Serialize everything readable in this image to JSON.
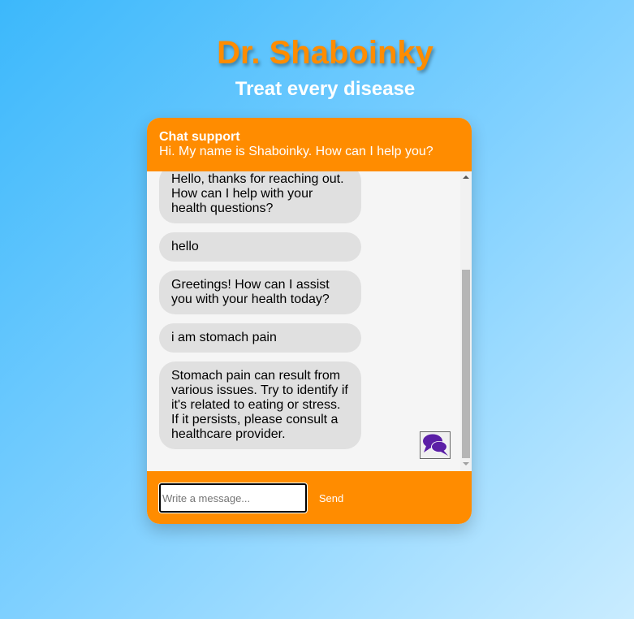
{
  "page": {
    "title": "Dr. Shaboinky",
    "subtitle": "Treat every disease"
  },
  "chat": {
    "header_title": "Chat support",
    "header_description": "Hi. My name is Shaboinky. How can I help you?",
    "messages": [
      {
        "text": "Hello, thanks for reaching out. How can I help with your health questions?"
      },
      {
        "text": "hello"
      },
      {
        "text": "Greetings! How can I assist you with your health today?"
      },
      {
        "text": "i am stomach pain"
      },
      {
        "text": "Stomach pain can result from various issues. Try to identify if it's related to eating or stress. If it persists, please consult a healthcare provider."
      }
    ],
    "input_placeholder": "Write a message...",
    "input_value": "",
    "send_label": "Send",
    "toggle_icon": "chat-bubbles-icon"
  },
  "colors": {
    "accent": "#ff8c00",
    "bubble": "#e0e0e0",
    "icon": "#5b1fa6"
  }
}
